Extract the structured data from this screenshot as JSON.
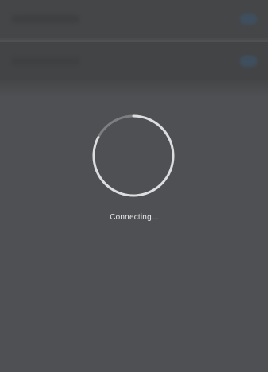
{
  "overlay": {
    "status_text": "Connecting...",
    "spinner_icon": "loading-spinner-icon",
    "colors": {
      "overlay_bg": "#4f5053",
      "spinner_track": "#8a8b8d",
      "spinner_arc": "#d9dadb",
      "text": "#e9e9ea"
    }
  }
}
